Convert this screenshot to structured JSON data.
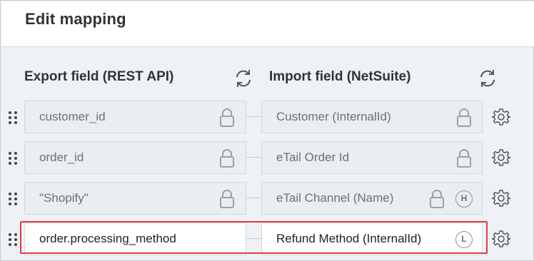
{
  "dialog": {
    "title": "Edit mapping"
  },
  "columns": {
    "export_header": "Export field (REST API)",
    "import_header": "Import field (NetSuite)"
  },
  "rows": [
    {
      "export": "customer_id",
      "export_locked": true,
      "import": "Customer (InternalId)",
      "import_locked": true,
      "badge": ""
    },
    {
      "export": "order_id",
      "export_locked": true,
      "import": "eTail Order Id",
      "import_locked": true,
      "badge": ""
    },
    {
      "export": "\"Shopify\"",
      "export_locked": true,
      "import": "eTail Channel (Name)",
      "import_locked": true,
      "badge": "H"
    },
    {
      "export": "order.processing_method",
      "export_locked": false,
      "import": "Refund Method (InternalId)",
      "import_locked": false,
      "badge": "L",
      "highlighted": true
    }
  ],
  "icons": {
    "handle": "drag-handle-icon",
    "lock": "lock-icon",
    "gear": "gear-icon",
    "refresh": "refresh-icon"
  },
  "colors": {
    "highlight": "#e23b3b",
    "locked_field_bg": "#e9eef2",
    "panel_bg": "#eef1f5"
  }
}
